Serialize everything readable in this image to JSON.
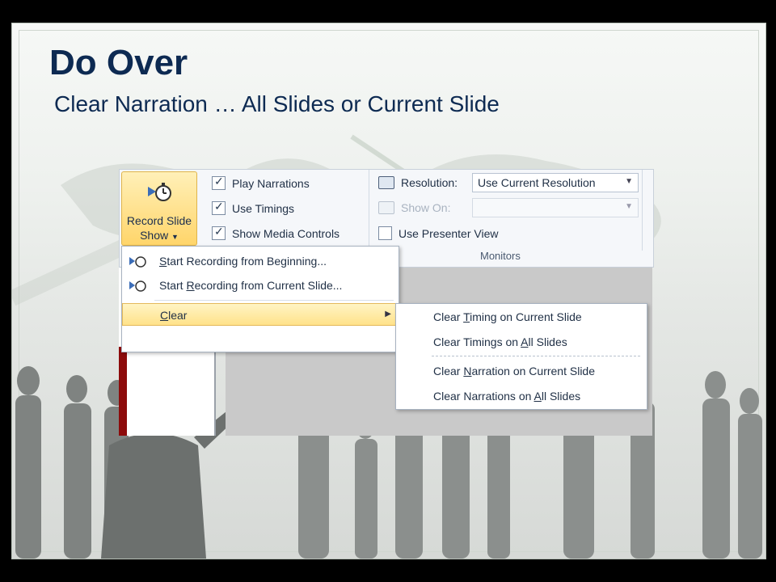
{
  "slide": {
    "title": "Do Over",
    "subtitle": "Clear Narration … All Slides or Current Slide"
  },
  "ribbon": {
    "record_button": {
      "line1": "Record Slide",
      "line2": "Show"
    },
    "checkboxes": [
      {
        "label": "Play Narrations",
        "checked": true
      },
      {
        "label": "Use Timings",
        "checked": true
      },
      {
        "label": "Show Media Controls",
        "checked": true
      }
    ],
    "resolution_label": "Resolution:",
    "resolution_value": "Use Current Resolution",
    "show_on_label": "Show On:",
    "presenter_view_label": "Use Presenter View",
    "monitors_group": "Monitors"
  },
  "menu": {
    "items": [
      {
        "pre": "",
        "u": "S",
        "post": "tart Recording from Beginning..."
      },
      {
        "pre": "Start ",
        "u": "R",
        "post": "ecording from Current Slide..."
      },
      {
        "pre": "",
        "u": "C",
        "post": "lear"
      }
    ]
  },
  "submenu": {
    "items": [
      {
        "pre": "Clear ",
        "u": "T",
        "post": "iming on Current Slide"
      },
      {
        "pre": "Clear Timings on ",
        "u": "A",
        "post": "ll Slides"
      },
      {
        "pre": "Clear ",
        "u": "N",
        "post": "arration on Current Slide"
      },
      {
        "pre": "Clear Narrations on ",
        "u": "A",
        "post": "ll Slides"
      }
    ]
  },
  "colors": {
    "title": "#0d2a52",
    "highlight": "#ffe28a",
    "frame": "#000000"
  },
  "icons": [
    "record-stopwatch-icon",
    "checkbox-icon",
    "resolution-icon",
    "show-on-icon",
    "dropdown-arrow-icon",
    "submenu-arrow-icon"
  ]
}
